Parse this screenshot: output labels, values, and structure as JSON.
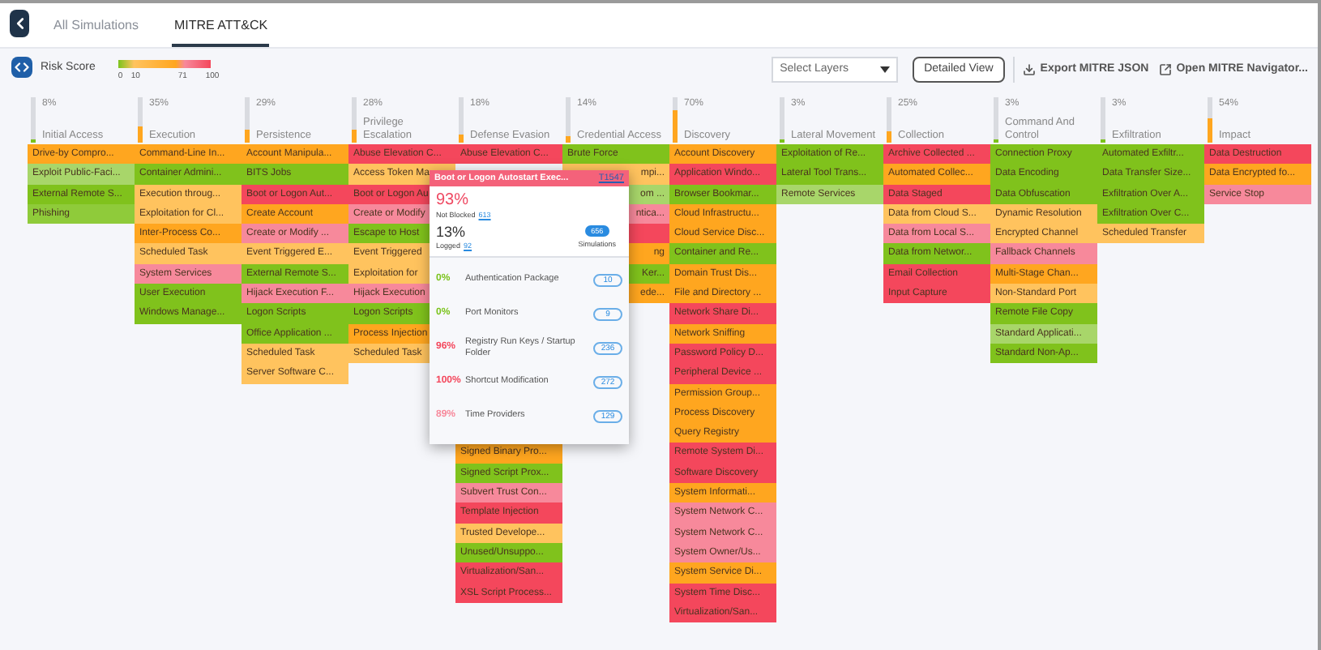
{
  "tabs": [
    {
      "label": "All Simulations",
      "selected": false
    },
    {
      "label": "MITRE ATT&CK",
      "selected": true
    }
  ],
  "toolbar": {
    "risk_label": "Risk Score",
    "ticks": [
      "0",
      "10",
      "71",
      "100"
    ],
    "layers": {
      "placeholder": "Select Layers"
    },
    "detailed_button": "Detailed View",
    "export_link": "Export MITRE JSON",
    "navigator_link": "Open MITRE Navigator..."
  },
  "matrix": {
    "columns": [
      {
        "percent": "8%",
        "level": 0.08,
        "name": "Initial Access",
        "cells": [
          {
            "kind": "technique",
            "label": "Drive-by Compro...",
            "color": "#ffa61f"
          },
          {
            "kind": "technique",
            "label": "Exploit Public-Faci...",
            "color": "#a8d66a"
          },
          {
            "kind": "technique",
            "label": "External Remote S...",
            "color": "#80c21c"
          },
          {
            "kind": "technique",
            "label": "Phishing",
            "color": "#8fcb3a"
          }
        ]
      },
      {
        "percent": "35%",
        "level": 0.35,
        "name": "Execution",
        "cells": [
          {
            "kind": "technique",
            "label": "Command-Line In...",
            "color": "#ffa61f"
          },
          {
            "kind": "technique",
            "label": "Container Admini...",
            "color": "#80c21c"
          },
          {
            "kind": "technique",
            "label": "Execution throug...",
            "color": "#ffc35e"
          },
          {
            "kind": "technique",
            "label": "Exploitation for Cl...",
            "color": "#ffc35e"
          },
          {
            "kind": "technique",
            "label": "Inter-Process Co...",
            "color": "#ffa61f"
          },
          {
            "kind": "technique",
            "label": "Scheduled Task",
            "color": "#ffc35e"
          },
          {
            "kind": "technique",
            "label": "System Services",
            "color": "#f7899b"
          },
          {
            "kind": "technique",
            "label": "User Execution",
            "color": "#80c21c"
          },
          {
            "kind": "technique",
            "label": "Windows Manage...",
            "color": "#80c21c"
          }
        ]
      },
      {
        "percent": "29%",
        "level": 0.29,
        "name": "Persistence",
        "cells": [
          {
            "kind": "technique",
            "label": "Account Manipula...",
            "color": "#ffa61f"
          },
          {
            "kind": "technique",
            "label": "BITS Jobs",
            "color": "#80c21c"
          },
          {
            "kind": "technique",
            "label": "Boot or Logon Aut...",
            "color": "#f4475c"
          },
          {
            "kind": "technique",
            "label": "Create Account",
            "color": "#ffa61f"
          },
          {
            "kind": "technique",
            "label": "Create or Modify ...",
            "color": "#f7899b"
          },
          {
            "kind": "technique",
            "label": "Event Triggered E...",
            "color": "#ffc35e"
          },
          {
            "kind": "technique",
            "label": "External Remote S...",
            "color": "#80c21c"
          },
          {
            "kind": "technique",
            "label": "Hijack Execution F...",
            "color": "#f7899b"
          },
          {
            "kind": "technique",
            "label": "Logon Scripts",
            "color": "#80c21c"
          },
          {
            "kind": "technique",
            "label": "Office Application ...",
            "color": "#80c21c"
          },
          {
            "kind": "technique",
            "label": "Scheduled Task",
            "color": "#ffc35e"
          },
          {
            "kind": "technique",
            "label": "Server Software C...",
            "color": "#ffc35e"
          }
        ]
      },
      {
        "percent": "28%",
        "level": 0.28,
        "name": "Privilege Escalation",
        "cells": [
          {
            "kind": "technique",
            "label": "Abuse Elevation C...",
            "color": "#f4475c"
          },
          {
            "kind": "technique",
            "label": "Access Token Ma",
            "color": "#ffc35e"
          },
          {
            "kind": "technique",
            "label": "Boot or Logon Au",
            "color": "#f4475c"
          },
          {
            "kind": "technique",
            "label": "Create or Modify",
            "color": "#f7899b"
          },
          {
            "kind": "technique",
            "label": "Escape to Host",
            "color": "#80c21c"
          },
          {
            "kind": "technique",
            "label": "Event Triggered",
            "color": "#ffc35e"
          },
          {
            "kind": "technique",
            "label": "Exploitation for",
            "color": "#ffc35e"
          },
          {
            "kind": "technique",
            "label": "Hijack Execution",
            "color": "#f7899b"
          },
          {
            "kind": "technique",
            "label": "Logon Scripts",
            "color": "#80c21c"
          },
          {
            "kind": "technique",
            "label": "Process Injection",
            "color": "#ffa61f"
          },
          {
            "kind": "technique",
            "label": "Scheduled Task",
            "color": "#ffc35e"
          }
        ]
      },
      {
        "percent": "18%",
        "level": 0.18,
        "name": "Defense Evasion",
        "cells": [
          {
            "kind": "technique",
            "label": "Abuse Elevation C...",
            "color": "#f4475c"
          },
          {
            "kind": "covered"
          },
          {
            "kind": "covered"
          },
          {
            "kind": "covered"
          },
          {
            "kind": "covered"
          },
          {
            "kind": "covered"
          },
          {
            "kind": "covered"
          },
          {
            "kind": "covered"
          },
          {
            "kind": "covered"
          },
          {
            "kind": "covered"
          },
          {
            "kind": "covered"
          },
          {
            "kind": "covered"
          },
          {
            "kind": "covered"
          },
          {
            "kind": "covered"
          },
          {
            "kind": "covered"
          },
          {
            "kind": "technique",
            "label": "Signed Binary Pro...",
            "color": "#ffa61f"
          },
          {
            "kind": "technique",
            "label": "Signed Script Prox...",
            "color": "#80c21c"
          },
          {
            "kind": "technique",
            "label": "Subvert Trust Con...",
            "color": "#f7899b"
          },
          {
            "kind": "technique",
            "label": "Template Injection",
            "color": "#f4475c"
          },
          {
            "kind": "technique",
            "label": "Trusted Develope...",
            "color": "#ffc35e"
          },
          {
            "kind": "technique",
            "label": "Unused/Unsuppo...",
            "color": "#80c21c"
          },
          {
            "kind": "technique",
            "label": "Virtualization/San...",
            "color": "#f4475c"
          },
          {
            "kind": "technique",
            "label": "XSL Script Process...",
            "color": "#f4475c"
          }
        ]
      },
      {
        "percent": "14%",
        "level": 0.14,
        "name": "Credential Access",
        "cells": [
          {
            "kind": "technique",
            "label": "Brute Force",
            "color": "#80c21c"
          },
          {
            "kind": "covered_left",
            "label": "mpi...",
            "color": "#ffc35e"
          },
          {
            "kind": "covered_left",
            "label": "om ...",
            "color": "#a8d66a"
          },
          {
            "kind": "covered_left",
            "label": "ntica...",
            "color": "#f7899b"
          },
          {
            "kind": "covered_left",
            "color": "#f4475c"
          },
          {
            "kind": "covered_left",
            "label": "ng",
            "color": "#ffa61f"
          },
          {
            "kind": "covered_left",
            "label": "Ker...",
            "color": "#80c21c"
          },
          {
            "kind": "covered_left",
            "label": "ede...",
            "color": "#ffa61f"
          }
        ]
      },
      {
        "percent": "70%",
        "level": 0.7,
        "name": "Discovery",
        "cells": [
          {
            "kind": "technique",
            "label": "Account Discovery",
            "color": "#ffa61f"
          },
          {
            "kind": "technique",
            "label": "Application Windo...",
            "color": "#f4475c"
          },
          {
            "kind": "technique",
            "label": "Browser Bookmar...",
            "color": "#80c21c"
          },
          {
            "kind": "technique",
            "label": "Cloud Infrastructu...",
            "color": "#ffa61f"
          },
          {
            "kind": "technique",
            "label": "Cloud Service Disc...",
            "color": "#ffa61f"
          },
          {
            "kind": "technique",
            "label": "Container and Re...",
            "color": "#80c21c"
          },
          {
            "kind": "technique",
            "label": "Domain Trust Dis...",
            "color": "#ffa61f"
          },
          {
            "kind": "technique",
            "label": "File and Directory ...",
            "color": "#ffa61f"
          },
          {
            "kind": "technique",
            "label": "Network Share Di...",
            "color": "#f4475c"
          },
          {
            "kind": "technique",
            "label": "Network Sniffing",
            "color": "#ffa61f"
          },
          {
            "kind": "technique",
            "label": "Password Policy D...",
            "color": "#f4475c"
          },
          {
            "kind": "technique",
            "label": "Peripheral Device ...",
            "color": "#f4475c"
          },
          {
            "kind": "technique",
            "label": "Permission Group...",
            "color": "#ffa61f"
          },
          {
            "kind": "technique",
            "label": "Process Discovery",
            "color": "#ffa61f"
          },
          {
            "kind": "technique",
            "label": "Query Registry",
            "color": "#ffa61f"
          },
          {
            "kind": "technique",
            "label": "Remote System Di...",
            "color": "#f4475c"
          },
          {
            "kind": "technique",
            "label": "Software Discovery",
            "color": "#f4475c"
          },
          {
            "kind": "technique",
            "label": "System Informati...",
            "color": "#ffa61f"
          },
          {
            "kind": "technique",
            "label": "System Network C...",
            "color": "#f7899b"
          },
          {
            "kind": "technique",
            "label": "System Network C...",
            "color": "#f7899b"
          },
          {
            "kind": "technique",
            "label": "System Owner/Us...",
            "color": "#f7899b"
          },
          {
            "kind": "technique",
            "label": "System Service Di...",
            "color": "#ffa61f"
          },
          {
            "kind": "technique",
            "label": "System Time Disc...",
            "color": "#f4475c"
          },
          {
            "kind": "technique",
            "label": "Virtualization/San...",
            "color": "#f4475c"
          }
        ]
      },
      {
        "percent": "3%",
        "level": 0.03,
        "name": "Lateral Movement",
        "cells": [
          {
            "kind": "technique",
            "label": "Exploitation of Re...",
            "color": "#80c21c"
          },
          {
            "kind": "technique",
            "label": "Lateral Tool Trans...",
            "color": "#80c21c"
          },
          {
            "kind": "technique",
            "label": "Remote Services",
            "color": "#a8d66a"
          }
        ]
      },
      {
        "percent": "25%",
        "level": 0.25,
        "name": "Collection",
        "cells": [
          {
            "kind": "technique",
            "label": "Archive Collected ...",
            "color": "#f4475c"
          },
          {
            "kind": "technique",
            "label": "Automated Collec...",
            "color": "#ffa61f"
          },
          {
            "kind": "technique",
            "label": "Data Staged",
            "color": "#f4475c"
          },
          {
            "kind": "technique",
            "label": "Data from Cloud S...",
            "color": "#ffc35e"
          },
          {
            "kind": "technique",
            "label": "Data from Local S...",
            "color": "#f7899b"
          },
          {
            "kind": "technique",
            "label": "Data from Networ...",
            "color": "#80c21c"
          },
          {
            "kind": "technique",
            "label": "Email Collection",
            "color": "#f4475c"
          },
          {
            "kind": "technique",
            "label": "Input Capture",
            "color": "#f4475c"
          }
        ]
      },
      {
        "percent": "3%",
        "level": 0.03,
        "name": "Command And Control",
        "cells": [
          {
            "kind": "technique",
            "label": "Connection Proxy",
            "color": "#80c21c"
          },
          {
            "kind": "technique",
            "label": "Data Encoding",
            "color": "#80c21c"
          },
          {
            "kind": "technique",
            "label": "Data Obfuscation",
            "color": "#80c21c"
          },
          {
            "kind": "technique",
            "label": "Dynamic Resolution",
            "color": "#ffc35e"
          },
          {
            "kind": "technique",
            "label": "Encrypted Channel",
            "color": "#ffc35e"
          },
          {
            "kind": "technique",
            "label": "Fallback Channels",
            "color": "#f7899b"
          },
          {
            "kind": "technique",
            "label": "Multi-Stage Chan...",
            "color": "#ffa61f"
          },
          {
            "kind": "technique",
            "label": "Non-Standard Port",
            "color": "#ffc35e"
          },
          {
            "kind": "technique",
            "label": "Remote File Copy",
            "color": "#80c21c"
          },
          {
            "kind": "technique",
            "label": "Standard Applicati...",
            "color": "#a8d66a"
          },
          {
            "kind": "technique",
            "label": "Standard Non-Ap...",
            "color": "#80c21c"
          }
        ]
      },
      {
        "percent": "3%",
        "level": 0.03,
        "name": "Exfiltration",
        "cells": [
          {
            "kind": "technique",
            "label": "Automated Exfiltr...",
            "color": "#80c21c"
          },
          {
            "kind": "technique",
            "label": "Data Transfer Size...",
            "color": "#80c21c"
          },
          {
            "kind": "technique",
            "label": "Exfiltration Over A...",
            "color": "#80c21c"
          },
          {
            "kind": "technique",
            "label": "Exfiltration Over C...",
            "color": "#80c21c"
          },
          {
            "kind": "technique",
            "label": "Scheduled Transfer",
            "color": "#ffc35e"
          }
        ]
      },
      {
        "percent": "54%",
        "level": 0.54,
        "name": "Impact",
        "cells": [
          {
            "kind": "technique",
            "label": "Data Destruction",
            "color": "#f4475c"
          },
          {
            "kind": "technique",
            "label": "Data Encrypted fo...",
            "color": "#ffa61f"
          },
          {
            "kind": "technique",
            "label": "Service Stop",
            "color": "#f7899b"
          }
        ]
      }
    ]
  },
  "popup": {
    "title": "Boot or Logon Autostart Exec...",
    "id_link": "T1547",
    "not_blocked_percent": "93%",
    "not_blocked_label": "Not Blocked",
    "not_blocked_count": "613",
    "logged_percent": "13%",
    "logged_label": "Logged",
    "logged_count": "92",
    "simulations_count": "656",
    "simulations_label": "Simulations",
    "rows": [
      {
        "percent": "0%",
        "color": "#7cc31d",
        "name": "Authentication Package",
        "count": "10"
      },
      {
        "percent": "0%",
        "color": "#7cc31d",
        "name": "Port Monitors",
        "count": "9"
      },
      {
        "percent": "96%",
        "color": "#f4475c",
        "name": "Registry Run Keys / Startup Folder",
        "count": "236"
      },
      {
        "percent": "100%",
        "color": "#f4475c",
        "name": "Shortcut Modification",
        "count": "272"
      },
      {
        "percent": "89%",
        "color": "#f7899b",
        "name": "Time Providers",
        "count": "129"
      }
    ]
  }
}
